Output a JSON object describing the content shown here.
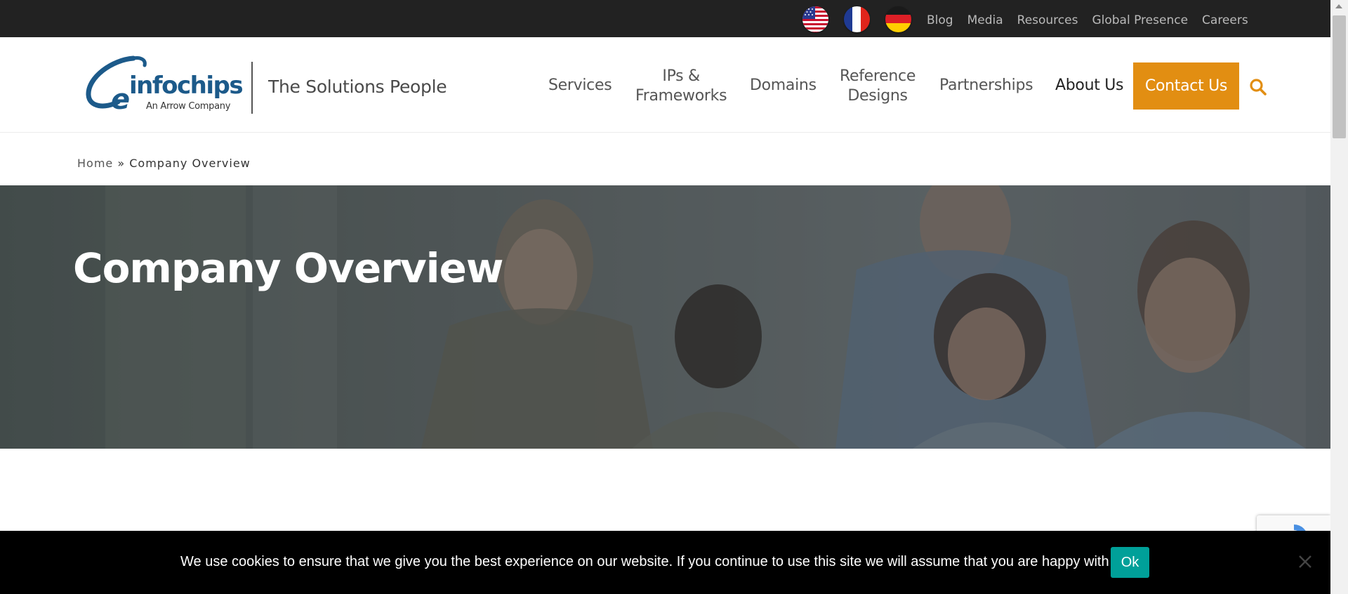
{
  "topbar": {
    "flags": [
      {
        "name": "us-flag-icon",
        "label": "English (US)"
      },
      {
        "name": "france-flag-icon",
        "label": "Français"
      },
      {
        "name": "germany-flag-icon",
        "label": "Deutsch"
      }
    ],
    "links": [
      "Blog",
      "Media",
      "Resources",
      "Global Presence",
      "Careers"
    ]
  },
  "header": {
    "logo_main": "einfochips",
    "logo_sub": "An Arrow Company",
    "tagline": "The Solutions People",
    "nav": {
      "services": "Services",
      "ips_line1": "IPs &",
      "ips_line2": "Frameworks",
      "domains": "Domains",
      "reference_line1": "Reference",
      "reference_line2": "Designs",
      "partnerships": "Partnerships",
      "about": "About Us"
    },
    "contact_label": "Contact Us",
    "search_icon": "search-icon"
  },
  "breadcrumb": {
    "home": "Home",
    "separator": "»",
    "current": "Company Overview"
  },
  "hero": {
    "title": "Company Overview"
  },
  "cookie": {
    "text": "We use cookies to ensure that we give you the best experience on our website. If you continue to use this site we will assume that you are happy with it.",
    "ok_label": "Ok"
  },
  "colors": {
    "topbar_bg": "#222222",
    "accent_orange": "#e28e12",
    "cookie_ok": "#00a099",
    "logo_blue": "#1c5a8a"
  }
}
